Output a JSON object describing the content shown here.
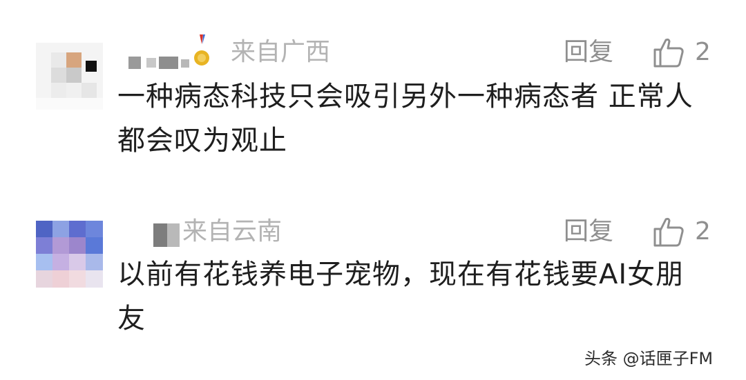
{
  "comments": [
    {
      "location": "来自广西",
      "reply_label": "回复",
      "like_count": "2",
      "text": "一种病态科技只会吸引另外一种病态者 正常人都会叹为观止"
    },
    {
      "location": "来自云南",
      "reply_label": "回复",
      "like_count": "2",
      "text": "以前有花钱养电子宠物，现在有花钱要AI女朋友"
    }
  ],
  "watermark": "头条 @话匣子FM",
  "icons": {
    "like": "thumbs-up-icon",
    "medal": "medal-icon"
  },
  "colors": {
    "text": "#1e1e1e",
    "meta": "#b3b3b3",
    "action": "#8f8f8f",
    "medal_gold": "#e8b423",
    "medal_ribbon": "#d9342b"
  }
}
